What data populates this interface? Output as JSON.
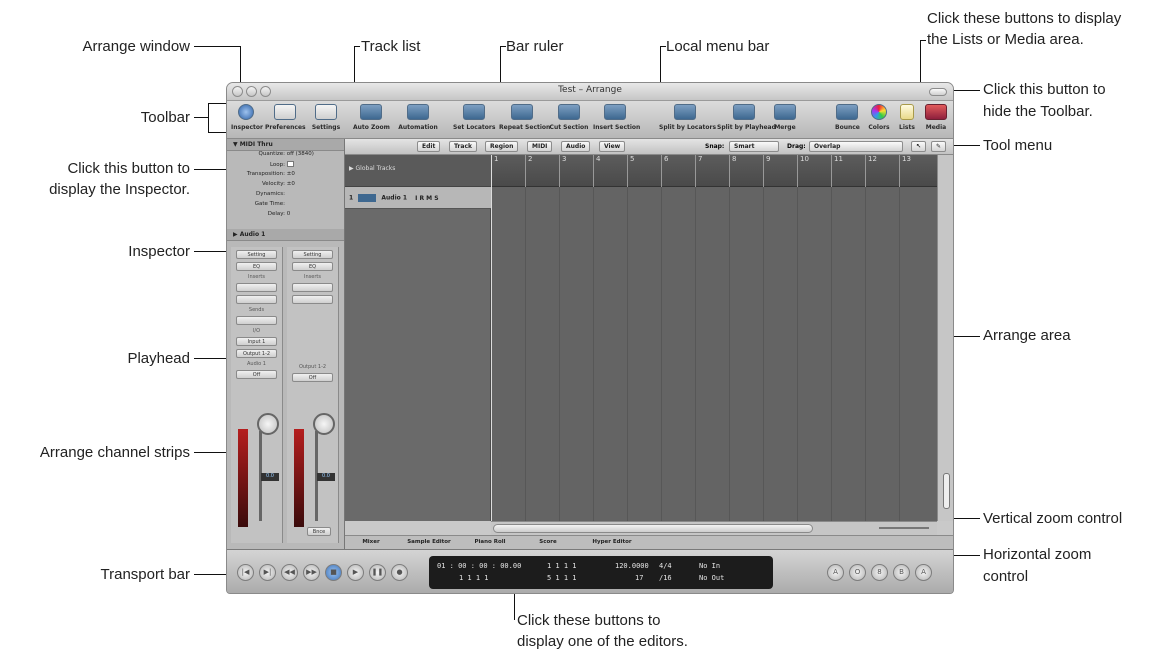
{
  "callouts": {
    "arrange_window": "Arrange window",
    "track_list": "Track list",
    "bar_ruler": "Bar ruler",
    "local_menu_bar": "Local menu bar",
    "lists_media": [
      "Click these buttons to display",
      "the Lists or Media area."
    ],
    "toolbar": "Toolbar",
    "hide_toolbar": [
      "Click this button to",
      "hide the Toolbar."
    ],
    "inspector_button": [
      "Click this button to",
      "display the Inspector."
    ],
    "tool_menu": "Tool menu",
    "inspector": "Inspector",
    "arrange_area": "Arrange area",
    "playhead": "Playhead",
    "channel_strips": "Arrange channel strips",
    "vertical_zoom": "Vertical zoom control",
    "horizontal_zoom": [
      "Horizontal zoom",
      "control"
    ],
    "transport_bar": "Transport bar",
    "editors": [
      "Click these buttons to",
      "display one of the editors."
    ]
  },
  "window": {
    "title": "Test – Arrange",
    "toolbar_buttons": [
      "Inspector",
      "Preferences",
      "Settings",
      "Auto Zoom",
      "Automation",
      "Set Locators",
      "Repeat Section",
      "Cut Section",
      "Insert Section",
      "Split by Locators",
      "Split by Playhead",
      "Merge",
      "Bounce",
      "Colors",
      "Lists",
      "Media"
    ],
    "inspector": {
      "region_header": "▼ MIDI Thru",
      "params": [
        {
          "label": "Quantize:",
          "value": "off (3840)"
        },
        {
          "label": "Loop:",
          "value": ""
        },
        {
          "label": "Transposition:",
          "value": "±0"
        },
        {
          "label": "Velocity:",
          "value": "±0"
        },
        {
          "label": "Dynamics:",
          "value": ""
        },
        {
          "label": "Gate Time:",
          "value": ""
        },
        {
          "label": "Delay:",
          "value": "0"
        }
      ],
      "track_header": "▶ Audio 1",
      "strip1": {
        "setting": "Setting",
        "eq": "EQ",
        "inserts": "Inserts",
        "sends": "Sends",
        "io": "I/O",
        "input": "Input 1",
        "output": "Output 1-2",
        "name": "Audio 1",
        "mode": "Off",
        "level": "0.0"
      },
      "strip2": {
        "setting": "Setting",
        "eq": "EQ",
        "inserts": "Inserts",
        "output": "Output 1-2",
        "mode": "Off",
        "level": "0.0",
        "bottom": "Bnce"
      }
    },
    "local_menus": [
      "Edit",
      "Track",
      "Region",
      "MIDI",
      "Audio",
      "View"
    ],
    "snap_label": "Snap:",
    "snap_value": "Smart",
    "drag_label": "Drag:",
    "drag_value": "Overlap",
    "global_tracks": "▶ Global Tracks",
    "track1": {
      "number": "1",
      "name": "Audio 1",
      "buttons": "I R M S"
    },
    "ruler_bars": [
      "1",
      "2",
      "3",
      "4",
      "5",
      "6",
      "7",
      "8",
      "9",
      "10",
      "11",
      "12",
      "13"
    ],
    "editor_tabs": [
      "Mixer",
      "Sample Editor",
      "Piano Roll",
      "Score",
      "Hyper Editor"
    ],
    "transport": {
      "buttons": [
        "|◀",
        "▶|",
        "◀◀",
        "▶▶",
        "■",
        "▶",
        "❚❚",
        "●"
      ],
      "time_smpte": "01 : 00 : 00 : 00.00",
      "time_bars": "1    1    1    1",
      "left_locator": "1    1    1    1",
      "right_locator": "5    1    1    1",
      "tempo": "120.0000",
      "signature": "4/4",
      "division_a": "17",
      "division_b": "/16",
      "midi_in": "No In",
      "midi_out": "No Out",
      "right_buttons": [
        "A",
        "O",
        "8",
        "B",
        "A"
      ]
    }
  },
  "colors": {
    "window_bg": "#c9c9c9",
    "arrange_bg": "#646464",
    "accent": "#3e6890"
  }
}
